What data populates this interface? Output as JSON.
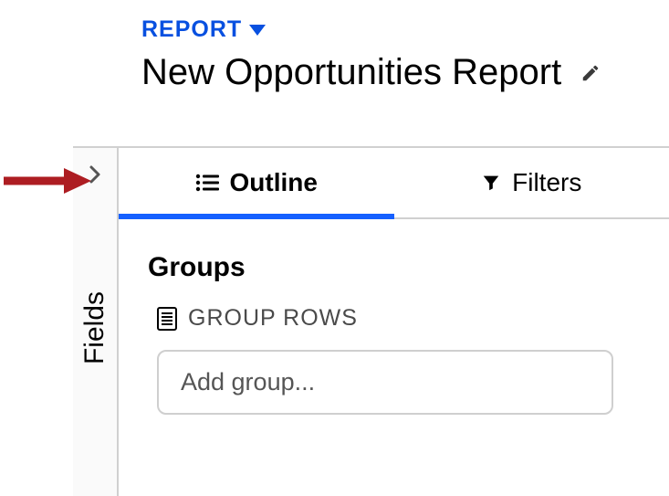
{
  "header": {
    "type_label": "REPORT",
    "title": "New Opportunities Report"
  },
  "sidebar": {
    "fields_label": "Fields"
  },
  "tabs": {
    "outline": {
      "label": "Outline"
    },
    "filters": {
      "label": "Filters"
    }
  },
  "groups": {
    "heading": "Groups",
    "rows_label": "GROUP ROWS",
    "add_placeholder": "Add group..."
  }
}
